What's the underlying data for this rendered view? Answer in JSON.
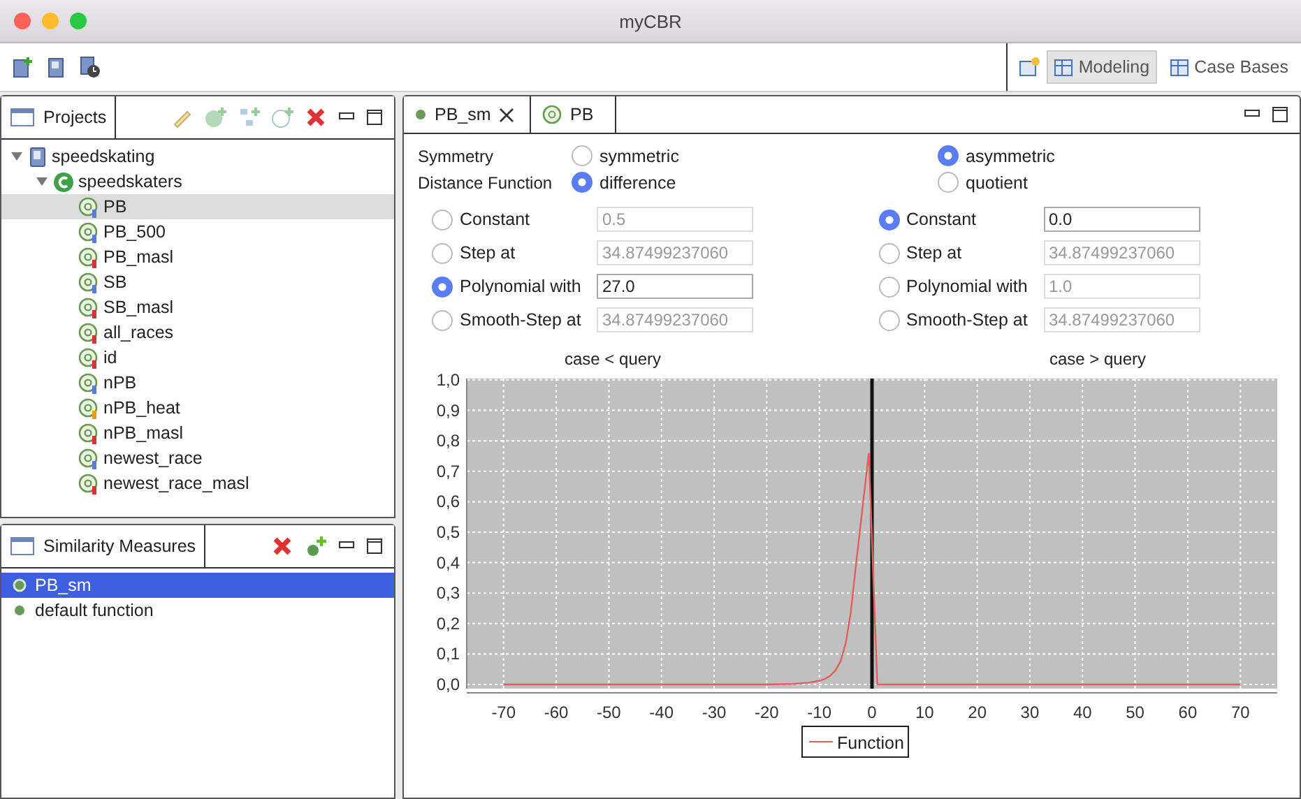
{
  "window": {
    "title": "myCBR"
  },
  "toolbar": {
    "perspectives": [
      {
        "label": "Modeling",
        "selected": true
      },
      {
        "label": "Case Bases",
        "selected": false
      }
    ]
  },
  "projects": {
    "title": "Projects",
    "tree": [
      {
        "label": "speedskating",
        "kind": "project",
        "expanded": true,
        "selected": false,
        "children": [
          {
            "label": "speedskaters",
            "kind": "concept",
            "expanded": true,
            "selected": false,
            "children": [
              {
                "label": "PB",
                "kind": "float",
                "selected": true
              },
              {
                "label": "PB_500",
                "kind": "float",
                "selected": false
              },
              {
                "label": "PB_masl",
                "kind": "integer",
                "selected": false
              },
              {
                "label": "SB",
                "kind": "float",
                "selected": false
              },
              {
                "label": "SB_masl",
                "kind": "integer",
                "selected": false
              },
              {
                "label": "all_races",
                "kind": "integer",
                "selected": false
              },
              {
                "label": "id",
                "kind": "integer",
                "selected": false
              },
              {
                "label": "nPB",
                "kind": "float",
                "selected": false
              },
              {
                "label": "nPB_heat",
                "kind": "symbol",
                "selected": false
              },
              {
                "label": "nPB_masl",
                "kind": "integer",
                "selected": false
              },
              {
                "label": "newest_race",
                "kind": "float",
                "selected": false
              },
              {
                "label": "newest_race_masl",
                "kind": "integer",
                "selected": false
              }
            ]
          }
        ]
      }
    ]
  },
  "similarity_measures": {
    "title": "Similarity Measures",
    "items": [
      {
        "label": "PB_sm",
        "selected": true
      },
      {
        "label": "default function",
        "selected": false
      }
    ]
  },
  "editor": {
    "tabs": [
      {
        "label": "PB_sm",
        "kind": "measure",
        "selected": true
      },
      {
        "label": "PB",
        "kind": "attribute",
        "selected": false
      }
    ],
    "symmetry": {
      "label": "Symmetry",
      "options": [
        {
          "label": "symmetric",
          "selected": false
        },
        {
          "label": "asymmetric",
          "selected": true
        }
      ]
    },
    "distance_function": {
      "label": "Distance Function",
      "options": [
        {
          "label": "difference",
          "selected": true
        },
        {
          "label": "quotient",
          "selected": false
        }
      ]
    },
    "left_functions": [
      {
        "label": "Constant",
        "selected": false,
        "value": "0.5"
      },
      {
        "label": "Step at",
        "selected": false,
        "value": "34.87499237060"
      },
      {
        "label": "Polynomial with",
        "selected": true,
        "value": "27.0"
      },
      {
        "label": "Smooth-Step at",
        "selected": false,
        "value": "34.87499237060"
      }
    ],
    "right_functions": [
      {
        "label": "Constant",
        "selected": true,
        "value": "0.0"
      },
      {
        "label": "Step at",
        "selected": false,
        "value": "34.87499237060"
      },
      {
        "label": "Polynomial with",
        "selected": false,
        "value": "1.0"
      },
      {
        "label": "Smooth-Step at",
        "selected": false,
        "value": "34.87499237060"
      }
    ],
    "left_heading": "case < query",
    "right_heading": "case > query",
    "chart_data": {
      "type": "line",
      "xlim": [
        -77,
        77
      ],
      "ylim": [
        0,
        1
      ],
      "xticks": [
        {
          "value": -70,
          "label": "-70"
        },
        {
          "value": -60,
          "label": "-60"
        },
        {
          "value": -50,
          "label": "-50"
        },
        {
          "value": -40,
          "label": "-40"
        },
        {
          "value": -30,
          "label": "-30"
        },
        {
          "value": -20,
          "label": "-20"
        },
        {
          "value": -10,
          "label": "-10"
        },
        {
          "value": 0,
          "label": "0"
        },
        {
          "value": 10,
          "label": "10"
        },
        {
          "value": 20,
          "label": "20"
        },
        {
          "value": 30,
          "label": "30"
        },
        {
          "value": 40,
          "label": "40"
        },
        {
          "value": 50,
          "label": "50"
        },
        {
          "value": 60,
          "label": "60"
        },
        {
          "value": 70,
          "label": "70"
        }
      ],
      "yticks": [
        {
          "value": 0,
          "label": "0,0"
        },
        {
          "value": 0.1,
          "label": "0,1"
        },
        {
          "value": 0.2,
          "label": "0,2"
        },
        {
          "value": 0.3,
          "label": "0,3"
        },
        {
          "value": 0.4,
          "label": "0,4"
        },
        {
          "value": 0.5,
          "label": "0,5"
        },
        {
          "value": 0.6,
          "label": "0,6"
        },
        {
          "value": 0.7,
          "label": "0,7"
        },
        {
          "value": 0.8,
          "label": "0,8"
        },
        {
          "value": 0.9,
          "label": "0,9"
        },
        {
          "value": 1,
          "label": "1,0"
        }
      ],
      "x": [
        -70,
        -20,
        -15,
        -12,
        -10,
        -9,
        -8,
        -7,
        -6,
        -5,
        -4,
        -3,
        -2,
        -1,
        -0.6,
        1,
        70
      ],
      "series": [
        {
          "name": "Function",
          "color": "#e06060",
          "values": [
            0,
            0,
            0.002,
            0.006,
            0.012,
            0.018,
            0.028,
            0.045,
            0.075,
            0.135,
            0.24,
            0.4,
            0.55,
            0.7,
            0.76,
            0,
            0
          ]
        }
      ],
      "grid": true,
      "ref_lines": [
        {
          "axis": "x",
          "value": 0
        }
      ]
    }
  }
}
